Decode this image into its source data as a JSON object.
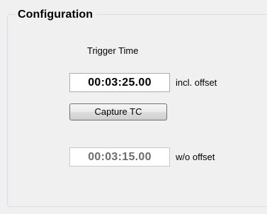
{
  "group": {
    "title": "Configuration"
  },
  "trigger": {
    "label": "Trigger Time",
    "incl_offset_value": "00:03:25.00",
    "incl_offset_label": "incl. offset",
    "capture_button_label": "Capture TC",
    "wo_offset_value": "00:03:15.00",
    "wo_offset_label": "w/o offset"
  }
}
